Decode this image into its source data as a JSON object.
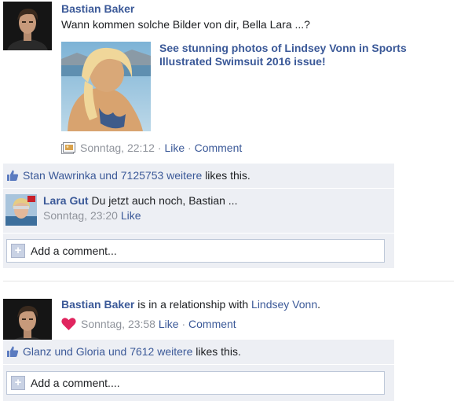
{
  "story1": {
    "author": "Bastian Baker",
    "message": "Wann kommen solche Bilder von dir, Bella Lara ...?",
    "attachment_title": "See stunning photos of Lindsey Vonn in Sports Illustrated Swimsuit 2016 issue!",
    "timestamp": "Sonntag, 22:12",
    "like_label": "Like",
    "comment_label": "Comment",
    "separator": "·",
    "likes": {
      "name": "Stan Wawrinka",
      "and_text": "und",
      "others": "7125753 weitere",
      "suffix": "likes this."
    },
    "comment": {
      "author": "Lara Gut",
      "text": "Du jetzt auch noch, Bastian ...",
      "timestamp": "Sonntag, 23:20",
      "like_label": "Like"
    },
    "add_comment": "Add a comment..."
  },
  "story2": {
    "author": "Bastian Baker",
    "relation_text": "is in a relationship with",
    "partner": "Lindsey Vonn",
    "period": ".",
    "timestamp": "Sonntag, 23:58",
    "like_label": "Like",
    "comment_label": "Comment",
    "separator": "·",
    "likes": {
      "names": "Glanz und Gloria",
      "and_text": "und",
      "others": "7612 weitere",
      "suffix": "likes this."
    },
    "add_comment": "Add a comment...."
  },
  "colors": {
    "link": "#3b5998",
    "meta_grey": "#90949c",
    "ufi_background": "#edeff4",
    "heart_red": "#e0245e"
  },
  "icons": {
    "post_type": "photo-icon",
    "like": "thumbs-up-icon",
    "relationship": "heart-icon",
    "add_comment": "plus-icon"
  }
}
